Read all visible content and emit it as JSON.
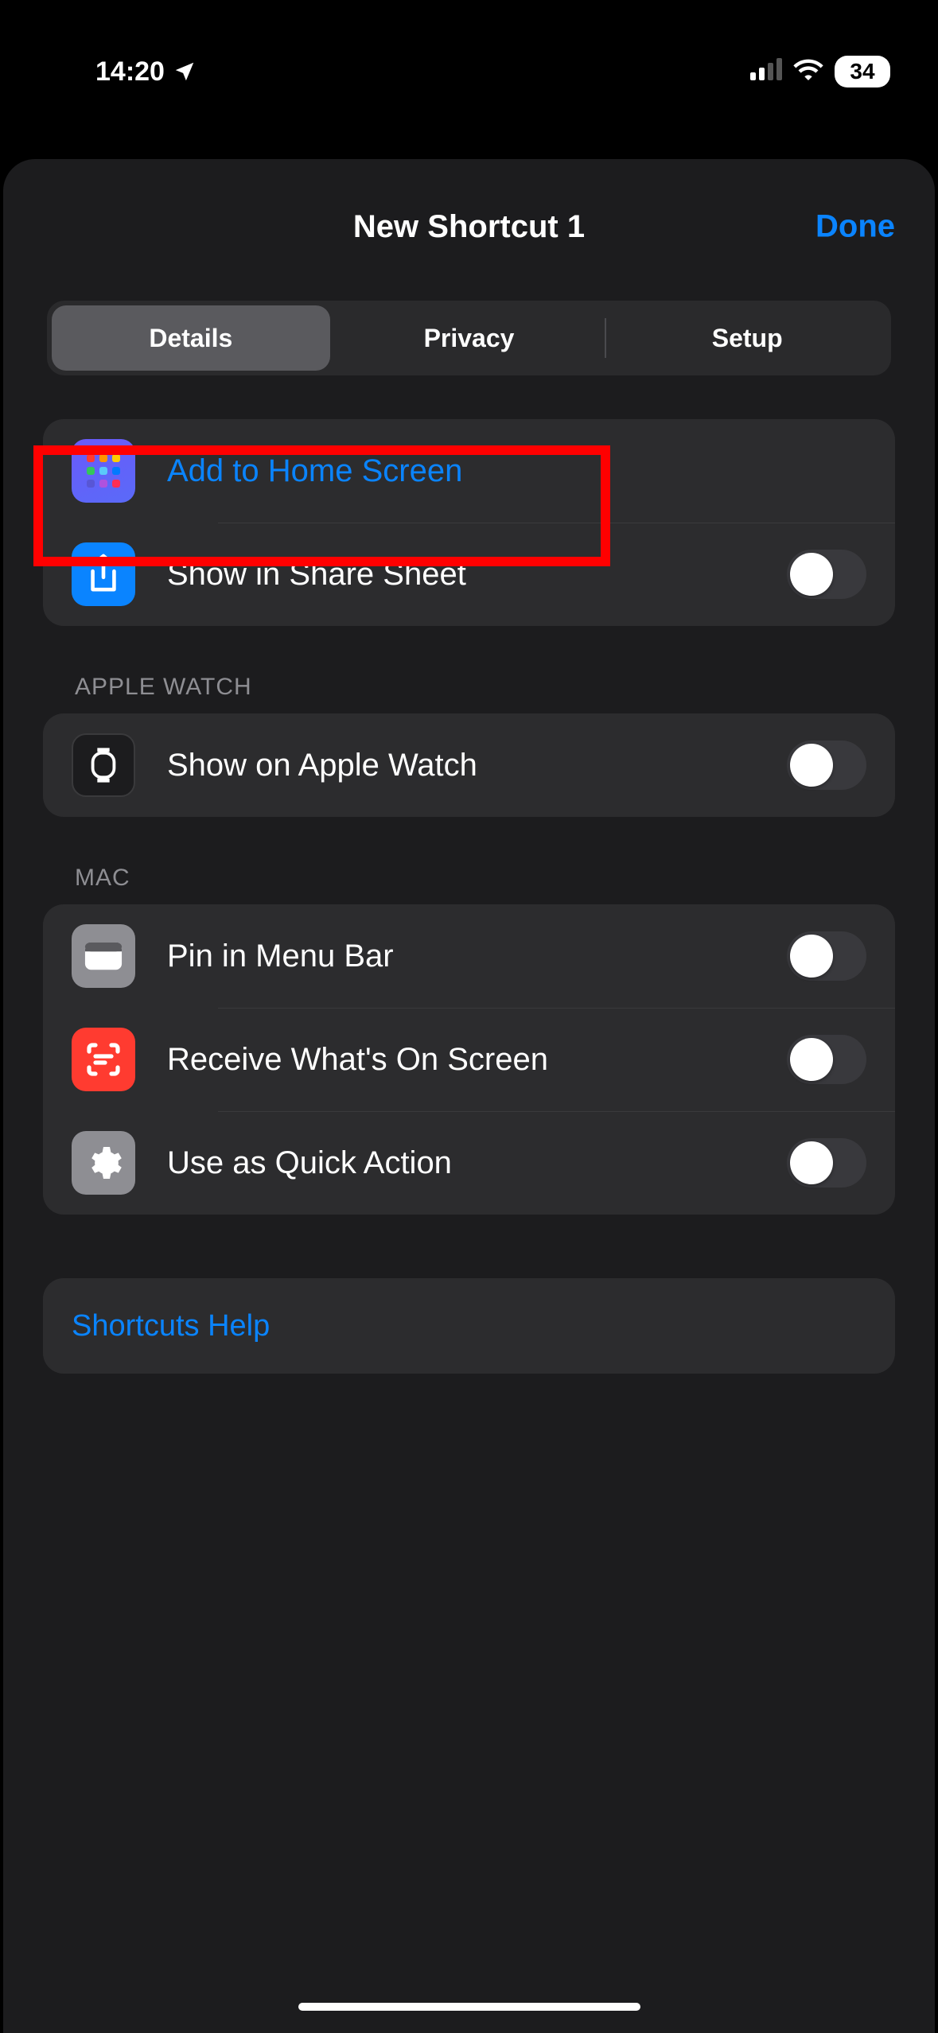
{
  "status": {
    "time": "14:20",
    "battery_pct": "34"
  },
  "sheet": {
    "title": "New Shortcut 1",
    "done_label": "Done"
  },
  "tabs": {
    "details": "Details",
    "privacy": "Privacy",
    "setup": "Setup",
    "active": "details"
  },
  "rows": {
    "add_home": "Add to Home Screen",
    "share_sheet": "Show in Share Sheet"
  },
  "sections": {
    "apple_watch": {
      "header": "Apple Watch",
      "show_watch": "Show on Apple Watch"
    },
    "mac": {
      "header": "Mac",
      "pin_menu": "Pin in Menu Bar",
      "receive_onscreen": "Receive What's On Screen",
      "quick_action": "Use as Quick Action"
    }
  },
  "help": {
    "shortcuts_help": "Shortcuts Help"
  },
  "toggles": {
    "share_sheet": false,
    "apple_watch": false,
    "pin_menu": false,
    "receive_onscreen": false,
    "quick_action": false
  }
}
